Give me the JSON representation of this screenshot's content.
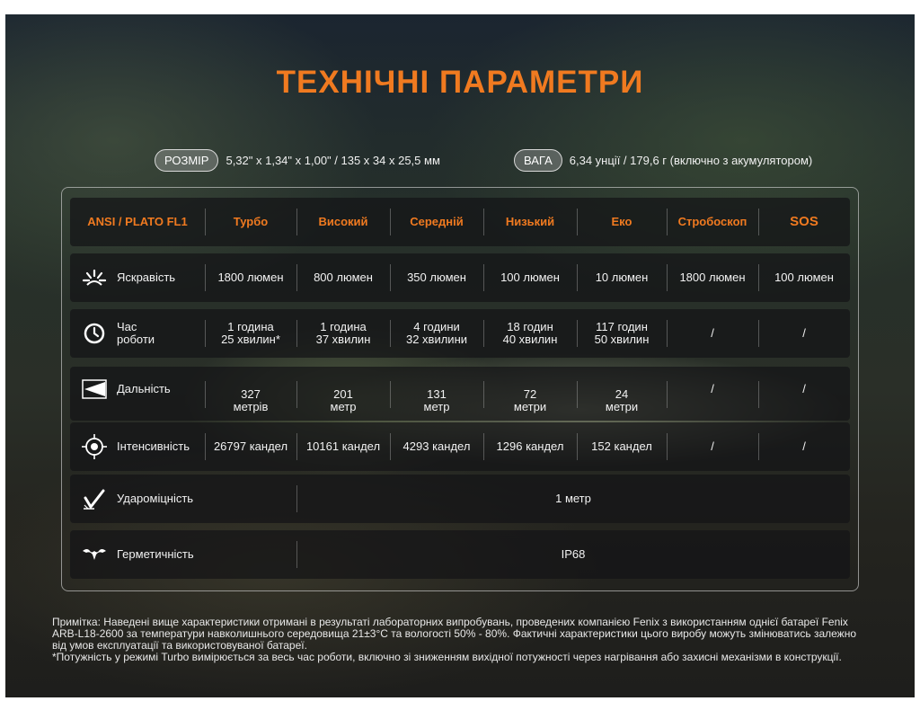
{
  "title": "ТЕХНІЧНІ ПАРАМЕТРИ",
  "size": {
    "label": "РОЗМІР",
    "value": "5,32\" x 1,34\" x 1,00\" / 135 x 34 x 25,5 мм"
  },
  "weight": {
    "label": "ВАГА",
    "value": "6,34 унції / 179,6 г (включно з акумулятором)"
  },
  "table": {
    "headers": [
      "ANSI / PLATO FL1",
      "Турбо",
      "Високий",
      "Середній",
      "Низький",
      "Еко",
      "Стробоскоп",
      "SOS"
    ],
    "rows": [
      {
        "label": "Яскравість",
        "values": [
          "1800 люмен",
          "800 люмен",
          "350 люмен",
          "100 люмен",
          "10 люмен",
          "1800 люмен",
          "100 люмен"
        ]
      },
      {
        "label_line1": "Час",
        "label_line2": "роботи",
        "values": [
          [
            "1 година",
            "25 хвилин*"
          ],
          [
            "1 година",
            "37 хвилин"
          ],
          [
            "4 години",
            "32 хвилини"
          ],
          [
            "18 годин",
            "40 хвилин"
          ],
          [
            "117 годин",
            "50 хвилин"
          ],
          [
            "/",
            ""
          ],
          [
            "/",
            ""
          ]
        ]
      },
      {
        "label": "Дальність",
        "values": [
          [
            "327",
            "метрів"
          ],
          [
            "201",
            "метр"
          ],
          [
            "131",
            "метр"
          ],
          [
            "72",
            "метри"
          ],
          [
            "24",
            "метри"
          ],
          [
            "/",
            ""
          ],
          [
            "/",
            ""
          ]
        ]
      },
      {
        "label": "Інтенсивність",
        "values": [
          "26797 кандел",
          "10161 кандел",
          "4293 кандел",
          "1296 кандел",
          "152 кандел",
          "/",
          "/"
        ]
      },
      {
        "label": "Удароміцність",
        "value": "1 метр"
      },
      {
        "label": "Герметичність",
        "value": "IP68"
      }
    ]
  },
  "note": {
    "line1": "Примітка: Наведені вище характеристики отримані в результаті лабораторних випробувань, проведених компанією Fenix з використанням однієї батареї Fenix ARB-L18-2600 за температури навколишнього середовища 21±3°C та вологості 50% - 80%. Фактичні характеристики цього виробу можуть змінюватись залежно від умов експлуатації та використовуваної батареї.",
    "line2": "*Потужність у режимі Turbo вимірюється за весь час роботи, включно зі зниженням вихідної потужності через нагрівання або захисні механізми в конструкції."
  },
  "colors": {
    "accent": "#f07a20",
    "text": "#f2f2f2",
    "row_bg": "#141416"
  },
  "icons": [
    "brightness-icon",
    "clock-icon",
    "beam-distance-icon",
    "intensity-target-icon",
    "impact-icon",
    "waterproof-icon"
  ]
}
